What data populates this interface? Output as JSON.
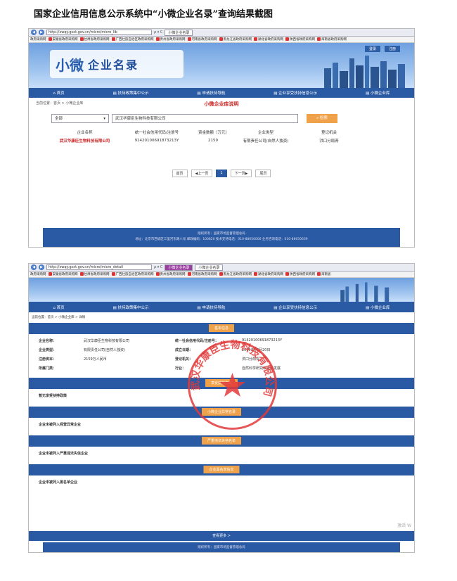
{
  "doc_title": "国家企业信用信息公示系统中“小微企业名录”查询结果截图",
  "shot1": {
    "url": "http://xwqy.gsxt.gov.cn/micro/micro_lib",
    "search_ctl": "ρ ▾ C",
    "tab": "小微企业名录",
    "favorites": [
      "政府采购网",
      "安徽省政府采购网",
      "甘肃省政府采购网",
      "广西壮族自治区政府采购网",
      "贵州省政府采购网",
      "河南省政府采购网",
      "黑龙江省政府采购网",
      "湖北省政府采购网",
      "陕西省政府采购网",
      "海南省政府采购网"
    ],
    "top_buttons": [
      "登录",
      "注册"
    ],
    "logo_mark": "小微",
    "logo_text": "企业名录",
    "nav": [
      "首页",
      "扶持政策集中公示",
      "申请扶持导航",
      "企业享受扶持信息公示",
      "小微企业库"
    ],
    "breadcrumb": "当前位置：首页 > 小微企业库",
    "section_title": "小微企业库说明",
    "select_value": "全部",
    "keyword": "武汉华康臣生物科技有限公司",
    "search_btn": "检索",
    "columns": [
      "企业名称",
      "统一社会信用代码/注册号",
      "资金数额（万元）",
      "企业类型",
      "登记机关"
    ],
    "row": {
      "name": "武汉华康臣生物科技有限公司",
      "code": "91420100691873213Y",
      "capital": "2159",
      "type": "有限责任公司(自然人独资)",
      "authority": "洪口分局青"
    },
    "pager": [
      "首页",
      "◀上一页",
      "1",
      "下一页▶",
      "尾页"
    ],
    "footer_line1": "版权所有：国家市场监督管理总局",
    "footer_line2": "地址：北京市西城区三里河东路八号  邮政编码：100820  技术支持电话：010-88650000  业务咨询电话：010-88650639"
  },
  "shot2": {
    "url": "http://xwqy.gsxt.gov.cn/micro/micro_detail",
    "search_ctl": "ρ ▾ C",
    "tabs": [
      "小微企业名录",
      "小微企业名录"
    ],
    "favorites": [
      "政府采购网",
      "安徽省政府采购网",
      "甘肃省政府采购网",
      "广西壮族自治区政府采购网",
      "贵州省政府采购网",
      "河南省政府采购网",
      "黑龙江省政府采购网",
      "湖北省政府采购网",
      "陕西省政府采购网",
      "海南省"
    ],
    "nav": [
      "首页",
      "扶持政策集中公示",
      "申请扶持导航",
      "企业享受扶持信息公示",
      "小微企业库"
    ],
    "breadcrumb": "当前位置：首页 > 小微企业库 > 详情",
    "bars": [
      "基本信息",
      "享受扶持信息",
      "小微企业异常名录",
      "严重违法失信名单",
      "企业黑名单信息"
    ],
    "info": [
      {
        "k1": "企业名称：",
        "v1": "武汉华康臣生物科技有限公司",
        "k2": "统一社会信用代码/注册号：",
        "v2": "91420100691873213Y"
      },
      {
        "k1": "企业类型：",
        "v1": "有限责任公司(自然人独资)",
        "k2": "成立日期：",
        "v2": "2009年07月20日"
      },
      {
        "k1": "注册资本：",
        "v1": "2159万人民币",
        "k2": "登记机关：",
        "v2": "洪口分局青"
      },
      {
        "k1": "所属门类：",
        "v1": "",
        "k2": "行业：",
        "v2": "自然科学研究和试验发展"
      }
    ],
    "subs": [
      "暂无享受扶持政策",
      "企业未被列入经营异常企业",
      "企业未被列入严重违法失信企业",
      "企业未被列入黑名单企业"
    ],
    "more_bar": "查看更多 >",
    "footer": "版权所有：国家市场监督管理总局",
    "watermark": "激活 W",
    "stamp_text": "武汉华康臣生物科技有限公司"
  },
  "colors": {
    "nav_blue": "#2b5aa4",
    "accent_orange": "#f0a24a",
    "link_red": "#cc2222",
    "stamp_red": "#e23a3a"
  }
}
